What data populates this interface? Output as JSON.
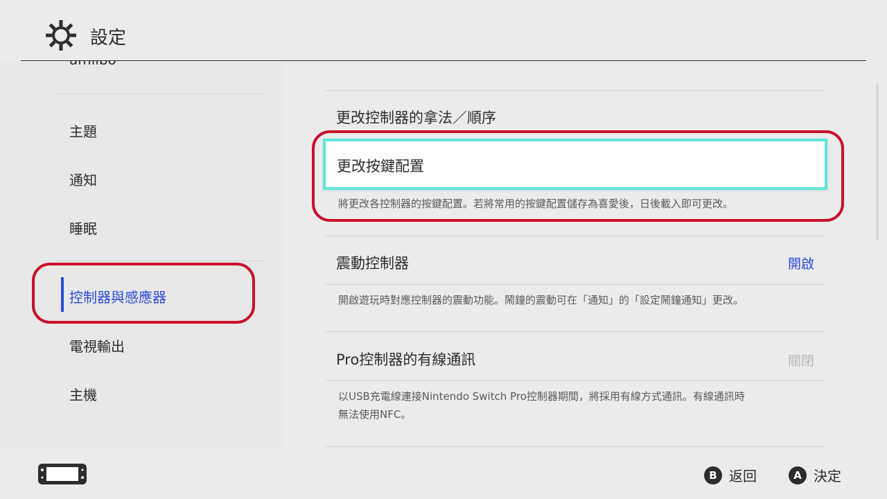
{
  "header": {
    "title": "設定",
    "icon": "gear-icon"
  },
  "sidebar": {
    "cut_item": "amiibo",
    "items": [
      {
        "label": "主題"
      },
      {
        "label": "通知"
      },
      {
        "label": "睡眠"
      },
      {
        "label": "控制器與感應器",
        "active": true
      },
      {
        "label": "電視輸出"
      },
      {
        "label": "主機"
      }
    ]
  },
  "content": {
    "items": [
      {
        "label": "更改控制器的拿法／順序"
      },
      {
        "label": "更改按鍵配置",
        "selected": true,
        "description": "將更改各控制器的按鍵配置。若將常用的按鍵配置儲存為喜愛後，日後載入即可更改。"
      },
      {
        "label": "震動控制器",
        "value": "開啟",
        "description": "開啟遊玩時對應控制器的震動功能。鬧鐘的震動可在「通知」的「設定鬧鐘通知」更改。"
      },
      {
        "label": "Pro控制器的有線通訊",
        "value": "關閉",
        "description_line1": "以USB充電線連接Nintendo Switch Pro控制器期間，將採用有線方式通訊。有線通訊時",
        "description_line2": "無法使用NFC。"
      }
    ]
  },
  "footer": {
    "console_icon": "handheld-console-icon",
    "back": {
      "button": "B",
      "label": "返回"
    },
    "ok": {
      "button": "A",
      "label": "決定"
    }
  },
  "colors": {
    "accent": "#2d49d6",
    "selection": "#5ee8d8",
    "highlight_oval": "#c9102b"
  }
}
